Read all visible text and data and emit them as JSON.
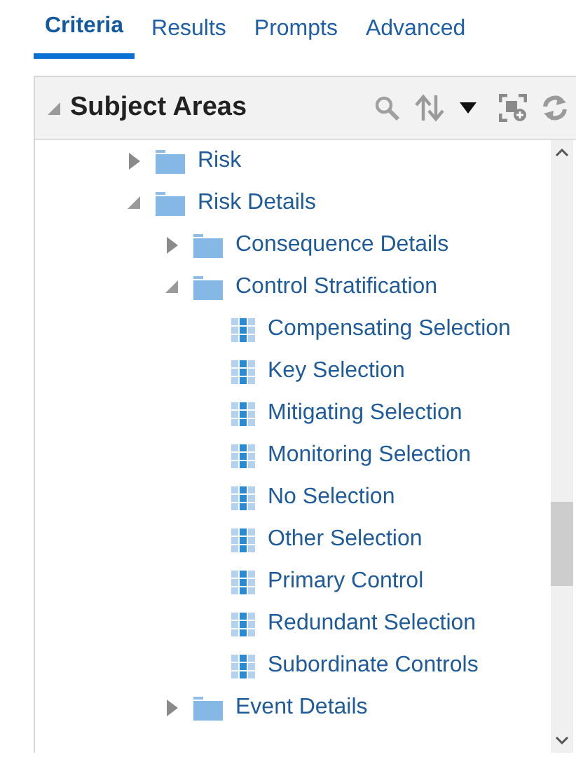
{
  "tabs": [
    {
      "label": "Criteria",
      "selected": true
    },
    {
      "label": "Results",
      "selected": false
    },
    {
      "label": "Prompts",
      "selected": false
    },
    {
      "label": "Advanced",
      "selected": false
    }
  ],
  "panel": {
    "title": "Subject Areas",
    "expanded": true
  },
  "tree": [
    {
      "kind": "folder",
      "label": "Risk",
      "expanded": false
    },
    {
      "kind": "folder",
      "label": "Risk Details",
      "expanded": true,
      "children": [
        {
          "kind": "folder",
          "label": "Consequence Details",
          "expanded": false
        },
        {
          "kind": "folder",
          "label": "Control Stratification",
          "expanded": true,
          "children": [
            {
              "kind": "column",
              "label": "Compensating Selection"
            },
            {
              "kind": "column",
              "label": "Key Selection"
            },
            {
              "kind": "column",
              "label": "Mitigating Selection"
            },
            {
              "kind": "column",
              "label": "Monitoring Selection"
            },
            {
              "kind": "column",
              "label": "No Selection"
            },
            {
              "kind": "column",
              "label": "Other Selection"
            },
            {
              "kind": "column",
              "label": "Primary Control"
            },
            {
              "kind": "column",
              "label": "Redundant Selection"
            },
            {
              "kind": "column",
              "label": "Subordinate Controls"
            }
          ]
        },
        {
          "kind": "folder",
          "label": "Event Details",
          "expanded": false
        }
      ]
    }
  ]
}
